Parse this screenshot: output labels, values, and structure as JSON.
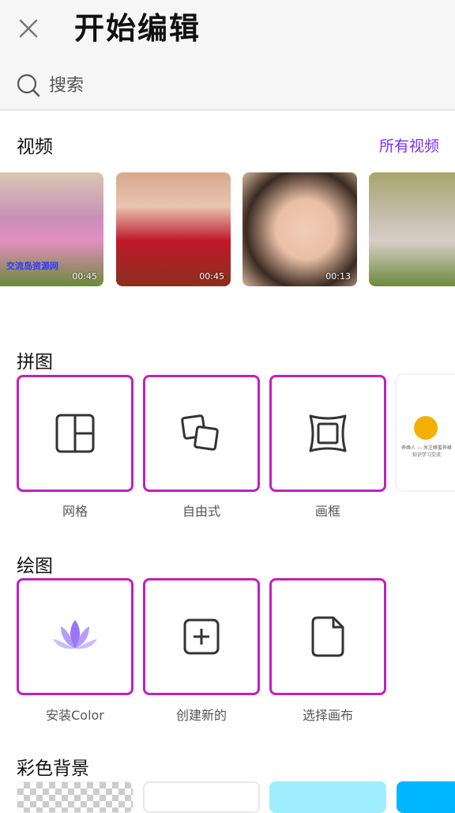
{
  "header": {
    "title": "开始编辑",
    "search_placeholder": "搜索"
  },
  "videos": {
    "section_title": "视频",
    "all_link": "所有视频",
    "items": [
      {
        "duration": "00:45",
        "watermark": "交流岛资源网"
      },
      {
        "duration": "00:45"
      },
      {
        "duration": "00:13"
      },
      {
        "duration": ""
      }
    ]
  },
  "collage": {
    "section_title": "拼图",
    "tiles": [
      {
        "label": "网格",
        "icon": "grid-layout-icon"
      },
      {
        "label": "自由式",
        "icon": "freestyle-icon"
      },
      {
        "label": "画框",
        "icon": "frame-icon"
      }
    ],
    "ad": {
      "text": "养蜂人 — 关注蜂蜜养蜂知识学习交流"
    }
  },
  "drawing": {
    "section_title": "绘图",
    "tiles": [
      {
        "label": "安装Color",
        "icon": "lotus-icon"
      },
      {
        "label": "创建新的",
        "icon": "add-canvas-icon"
      },
      {
        "label": "选择画布",
        "icon": "document-icon"
      }
    ]
  },
  "backgrounds": {
    "section_title": "彩色背景",
    "swatches": [
      "transparent",
      "#ffffff",
      "#9eeeff",
      "#00b7ff"
    ]
  },
  "colors": {
    "accent": "#7b2ff7",
    "tile_border": "#c020c0"
  }
}
